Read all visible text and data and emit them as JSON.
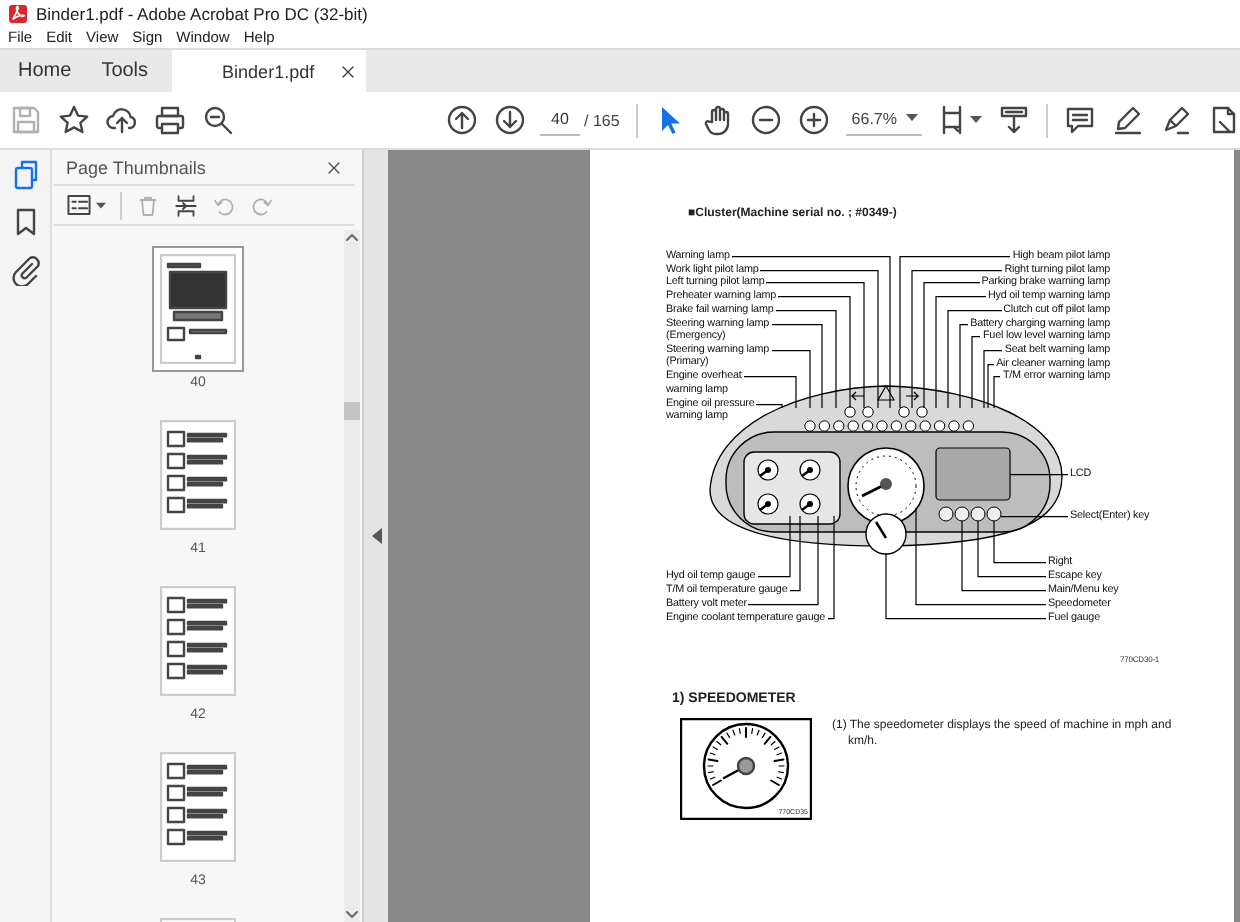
{
  "window": {
    "title": "Binder1.pdf - Adobe Acrobat Pro DC (32-bit)"
  },
  "menu": [
    "File",
    "Edit",
    "View",
    "Sign",
    "Window",
    "Help"
  ],
  "tabs": [
    {
      "label": "Home",
      "selected": false
    },
    {
      "label": "Tools",
      "selected": false
    },
    {
      "label": "Binder1.pdf",
      "selected": true
    }
  ],
  "toolbar": {
    "page": "40",
    "page_total": "/ 165",
    "zoom": "66.7%"
  },
  "side_rail": [
    {
      "kind": "pages",
      "selected": true
    },
    {
      "kind": "bookmarks",
      "selected": false
    },
    {
      "kind": "attachments",
      "selected": false
    }
  ],
  "thumbnails_panel": {
    "title": "Page Thumbnails",
    "pages": [
      {
        "label": "40",
        "selected": true
      },
      {
        "label": "41",
        "selected": false
      },
      {
        "label": "42",
        "selected": false
      },
      {
        "label": "43",
        "selected": false
      },
      {
        "selected": false
      }
    ]
  },
  "document": {
    "heading": "■Cluster(Machine serial no. ; #0349-)",
    "diagram": {
      "left_labels": [
        "Warning lamp",
        "Work light pilot lamp",
        "Left turning pilot lamp",
        "Preheater warning lamp",
        "Brake fail warning lamp",
        "Steering warning lamp\n(Emergency)",
        "Steering warning lamp\n(Primary)",
        "Engine overheat\nwarning lamp",
        "Engine oil pressure\nwarning lamp"
      ],
      "right_labels": [
        "High beam pilot lamp",
        "Right turning pilot lamp",
        "Parking brake warning lamp",
        "Hyd oil temp warning lamp",
        "Clutch cut off pilot lamp",
        "Battery charging warning lamp",
        "Fuel low level warning lamp",
        "Seat belt warning lamp",
        "Air cleaner warning lamp",
        "T/M error warning lamp"
      ],
      "bottom_left_labels": [
        "Hyd oil temp gauge",
        "T/M oil temperature gauge",
        "Battery volt meter",
        "Engine coolant temperature gauge"
      ],
      "bottom_right_labels": [
        "LCD",
        "Select(Enter) key",
        "Right",
        "Escape key",
        "Main/Menu key",
        "Speedometer",
        "Fuel gauge"
      ],
      "figure_code": "770CD30-1"
    },
    "section_title": "1) SPEEDOMETER",
    "paragraph": "(1) The speedometer displays the speed of machine in mph and km/h.",
    "figure_code": "770CD35"
  }
}
